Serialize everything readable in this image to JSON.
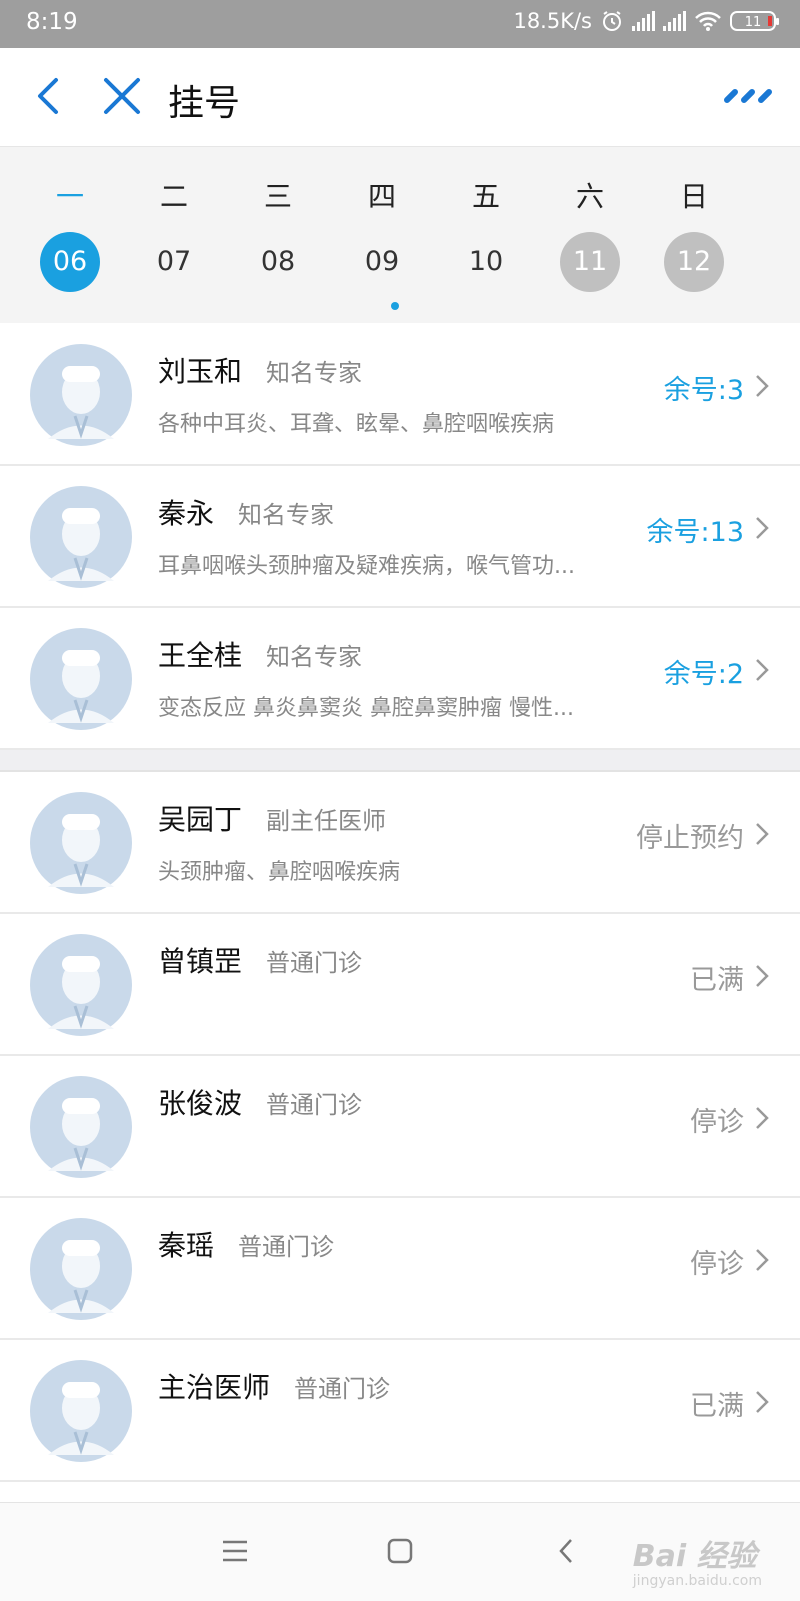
{
  "status_bar": {
    "time": "8:19",
    "network_speed": "18.5K/s",
    "hd": "HD",
    "battery": "11",
    "icons": [
      "alarm-icon",
      "hd-signal-icon",
      "signal-icon",
      "wifi-icon",
      "battery-icon"
    ]
  },
  "topbar": {
    "title": "挂号",
    "back_icon": "chevron-left-icon",
    "close_icon": "close-icon",
    "more_icon": "more-dots-icon",
    "accent": "#1a78d4"
  },
  "week": {
    "days": [
      {
        "weekday": "一",
        "date": "06",
        "state": "selected"
      },
      {
        "weekday": "二",
        "date": "07",
        "state": "normal"
      },
      {
        "weekday": "三",
        "date": "08",
        "state": "normal"
      },
      {
        "weekday": "四",
        "date": "09",
        "state": "normal"
      },
      {
        "weekday": "五",
        "date": "10",
        "state": "normal"
      },
      {
        "weekday": "六",
        "date": "11",
        "state": "off"
      },
      {
        "weekday": "日",
        "date": "12",
        "state": "off"
      }
    ],
    "accent": "#1aa0e0"
  },
  "experts": [
    {
      "name": "刘玉和",
      "title": "知名专家",
      "desc": "各种中耳炎、耳聋、眩晕、鼻腔咽喉疾病",
      "status": "余号:3"
    },
    {
      "name": "秦永",
      "title": "知名专家",
      "desc": "耳鼻咽喉头颈肿瘤及疑难疾病，喉气管功...",
      "status": "余号:13"
    },
    {
      "name": "王全桂",
      "title": "知名专家",
      "desc": "变态反应 鼻炎鼻窦炎 鼻腔鼻窦肿瘤 慢性...",
      "status": "余号:2"
    }
  ],
  "doctors": [
    {
      "name": "吴园丁",
      "title": "副主任医师",
      "desc": "头颈肿瘤、鼻腔咽喉疾病",
      "status": "停止预约"
    },
    {
      "name": "曾镇罡",
      "title": "普通门诊",
      "desc": "",
      "status": "已满"
    },
    {
      "name": "张俊波",
      "title": "普通门诊",
      "desc": "",
      "status": "停诊"
    },
    {
      "name": "秦瑶",
      "title": "普通门诊",
      "desc": "",
      "status": "停诊"
    },
    {
      "name": "主治医师",
      "title": "普通门诊",
      "desc": "",
      "status": "已满"
    }
  ],
  "navbar": {
    "icons": [
      "menu-icon",
      "home-square-icon",
      "back-icon"
    ],
    "watermark": "Bai 经验",
    "watermark_sub": "jingyan.baidu.com"
  }
}
